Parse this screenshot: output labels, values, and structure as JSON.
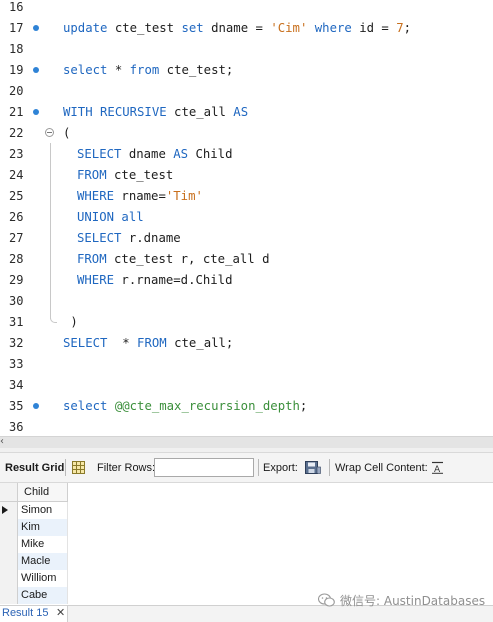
{
  "editor": {
    "lines": [
      {
        "num": "16",
        "dot": false,
        "fold": false,
        "indent": 0,
        "tokens": []
      },
      {
        "num": "17",
        "dot": true,
        "fold": false,
        "indent": 0,
        "tokens": [
          {
            "t": "kw",
            "v": "update"
          },
          {
            "t": "plain",
            "v": " cte_test "
          },
          {
            "t": "kw",
            "v": "set"
          },
          {
            "t": "plain",
            "v": " dname = "
          },
          {
            "t": "str",
            "v": "'Cim'"
          },
          {
            "t": "plain",
            "v": " "
          },
          {
            "t": "kw",
            "v": "where"
          },
          {
            "t": "plain",
            "v": " id = "
          },
          {
            "t": "str",
            "v": "7"
          },
          {
            "t": "plain",
            "v": ";"
          }
        ]
      },
      {
        "num": "18",
        "dot": false,
        "fold": false,
        "indent": 0,
        "tokens": []
      },
      {
        "num": "19",
        "dot": true,
        "fold": false,
        "indent": 0,
        "tokens": [
          {
            "t": "kw",
            "v": "select"
          },
          {
            "t": "plain",
            "v": " * "
          },
          {
            "t": "kw",
            "v": "from"
          },
          {
            "t": "plain",
            "v": " cte_test;"
          }
        ]
      },
      {
        "num": "20",
        "dot": false,
        "fold": false,
        "indent": 0,
        "tokens": []
      },
      {
        "num": "21",
        "dot": true,
        "fold": false,
        "indent": 0,
        "tokens": [
          {
            "t": "kw",
            "v": "WITH RECURSIVE"
          },
          {
            "t": "plain",
            "v": " cte_all "
          },
          {
            "t": "kw",
            "v": "AS"
          }
        ]
      },
      {
        "num": "22",
        "dot": false,
        "fold": true,
        "indent": 0,
        "tokens": [
          {
            "t": "plain",
            "v": "("
          }
        ]
      },
      {
        "num": "23",
        "dot": false,
        "fold": false,
        "indent": 1,
        "tokens": [
          {
            "t": "kw",
            "v": "SELECT"
          },
          {
            "t": "plain",
            "v": " dname "
          },
          {
            "t": "kw",
            "v": "AS"
          },
          {
            "t": "plain",
            "v": " Child"
          }
        ]
      },
      {
        "num": "24",
        "dot": false,
        "fold": false,
        "indent": 1,
        "tokens": [
          {
            "t": "kw",
            "v": "FROM"
          },
          {
            "t": "plain",
            "v": " cte_test"
          }
        ]
      },
      {
        "num": "25",
        "dot": false,
        "fold": false,
        "indent": 1,
        "tokens": [
          {
            "t": "kw",
            "v": "WHERE"
          },
          {
            "t": "plain",
            "v": " rname="
          },
          {
            "t": "str",
            "v": "'Tim'"
          }
        ]
      },
      {
        "num": "26",
        "dot": false,
        "fold": false,
        "indent": 1,
        "tokens": [
          {
            "t": "kw",
            "v": "UNION all"
          }
        ]
      },
      {
        "num": "27",
        "dot": false,
        "fold": false,
        "indent": 1,
        "tokens": [
          {
            "t": "kw",
            "v": "SELECT"
          },
          {
            "t": "plain",
            "v": " r.dname"
          }
        ]
      },
      {
        "num": "28",
        "dot": false,
        "fold": false,
        "indent": 1,
        "tokens": [
          {
            "t": "kw",
            "v": "FROM"
          },
          {
            "t": "plain",
            "v": " cte_test r, cte_all d"
          }
        ]
      },
      {
        "num": "29",
        "dot": false,
        "fold": false,
        "indent": 1,
        "tokens": [
          {
            "t": "kw",
            "v": "WHERE"
          },
          {
            "t": "plain",
            "v": " r.rname=d.Child"
          }
        ]
      },
      {
        "num": "30",
        "dot": false,
        "fold": false,
        "indent": 0,
        "tokens": []
      },
      {
        "num": "31",
        "dot": false,
        "fold": false,
        "indent": 0,
        "tokens": [
          {
            "t": "plain",
            "v": " )"
          }
        ]
      },
      {
        "num": "32",
        "dot": false,
        "fold": false,
        "indent": 0,
        "tokens": [
          {
            "t": "kw",
            "v": "SELECT"
          },
          {
            "t": "plain",
            "v": "  * "
          },
          {
            "t": "kw",
            "v": "FROM"
          },
          {
            "t": "plain",
            "v": " cte_all;"
          }
        ]
      },
      {
        "num": "33",
        "dot": false,
        "fold": false,
        "indent": 0,
        "tokens": []
      },
      {
        "num": "34",
        "dot": false,
        "fold": false,
        "indent": 0,
        "tokens": []
      },
      {
        "num": "35",
        "dot": true,
        "fold": false,
        "indent": 0,
        "tokens": [
          {
            "t": "kw",
            "v": "select"
          },
          {
            "t": "plain",
            "v": " "
          },
          {
            "t": "var",
            "v": "@@cte_max_recursion_depth"
          },
          {
            "t": "plain",
            "v": ";"
          }
        ]
      },
      {
        "num": "36",
        "dot": false,
        "fold": false,
        "indent": 0,
        "tokens": []
      }
    ]
  },
  "toolbar": {
    "result_grid_label": "Result Grid",
    "filter_rows_label": "Filter Rows:",
    "filter_value": "",
    "export_label": "Export:",
    "wrap_label": "Wrap Cell Content:"
  },
  "grid": {
    "column": "Child",
    "rows": [
      "Simon",
      "Kim",
      "Mike",
      "Macle",
      "Williom",
      "Cabe"
    ],
    "selected_row": 0
  },
  "tabs": {
    "result_tab": "Result 15",
    "close_glyph": "✕"
  },
  "watermark": "微信号: AustinDatabases",
  "colors": {
    "keyword": "#1f67c0",
    "string": "#c86f1c",
    "variable": "#3b8f3b",
    "statement_dot": "#2f83d6",
    "alt_row": "#eaf2fb"
  },
  "icons": {
    "result_grid": "grid-icon",
    "export": "export-disk-icon",
    "wrap": "wrap-text-icon",
    "watermark": "wechat-icon"
  }
}
